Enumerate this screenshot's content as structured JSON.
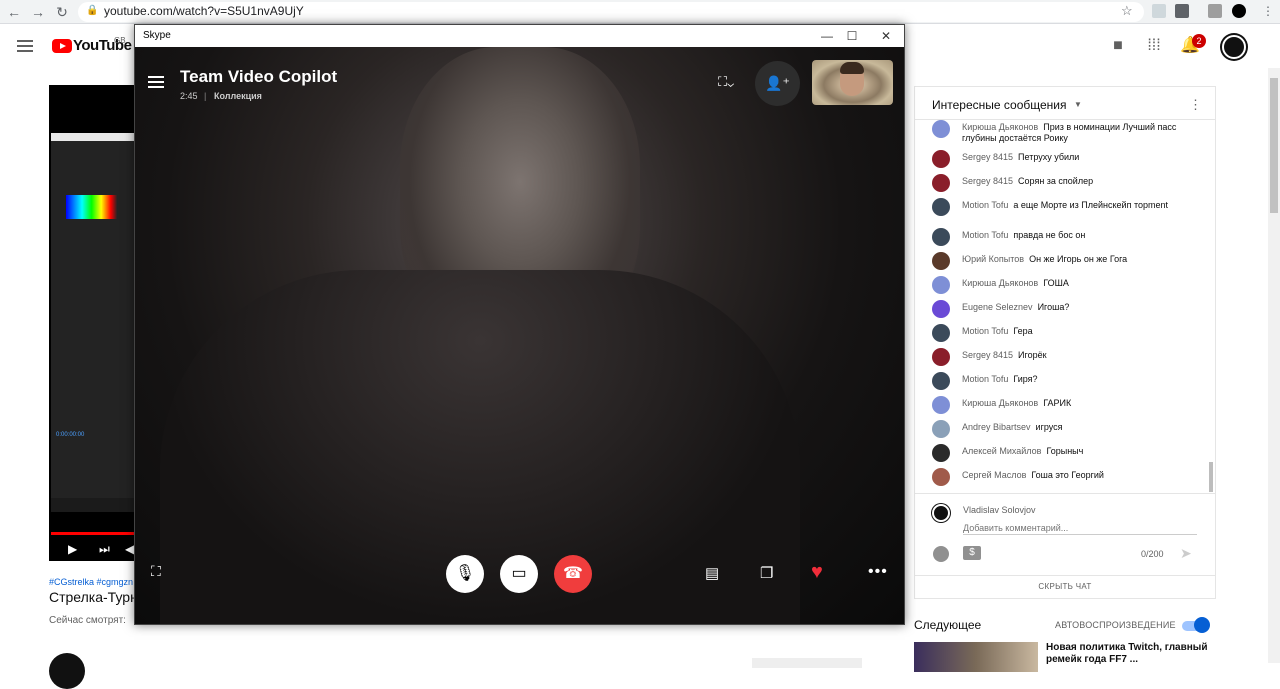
{
  "browser": {
    "url": "youtube.com/watch?v=S5U1nvA9UjY",
    "lock_glyph": "🔒",
    "star_glyph": "☆"
  },
  "youtube": {
    "logo_text": "YouTube",
    "region": "GB",
    "notification_count": "2",
    "video": {
      "tags": "#CGstrelka #cgmgzn",
      "title": "Стрелка-Турн",
      "watching": "Сейчас смотрят:",
      "ae_time": "0:00:00:00"
    },
    "chat": {
      "title": "Интересные сообщения",
      "messages": [
        {
          "author": "Кирюша Дьяконов",
          "text": "Приз в номинации Лучший пасс глубины достаётся Роику",
          "avatar_color": "#7e8fd6"
        },
        {
          "author": "Sergey 8415",
          "text": "Петруху убили",
          "avatar_color": "#8a1e2a"
        },
        {
          "author": "Sergey 8415",
          "text": "Сорян за спойлер",
          "avatar_color": "#8a1e2a"
        },
        {
          "author": "Motion Tofu",
          "text": "а еще Морте из Плейнскейп торment",
          "avatar_color": "#3b4a5a"
        },
        {
          "author": "Motion Tofu",
          "text": "правда не бос он",
          "avatar_color": "#3b4a5a"
        },
        {
          "author": "Юрий Копытов",
          "text": "Он же Игорь он же Гога",
          "avatar_color": "#5a3a2a"
        },
        {
          "author": "Кирюша Дьяконов",
          "text": "ГОША",
          "avatar_color": "#7e8fd6"
        },
        {
          "author": "Eugene Seleznev",
          "text": "Игоша?",
          "avatar_color": "#6a4ad6"
        },
        {
          "author": "Motion Tofu",
          "text": "Гера",
          "avatar_color": "#3b4a5a"
        },
        {
          "author": "Sergey 8415",
          "text": "Игорёк",
          "avatar_color": "#8a1e2a"
        },
        {
          "author": "Motion Tofu",
          "text": "Гиря?",
          "avatar_color": "#3b4a5a"
        },
        {
          "author": "Кирюша Дьяконов",
          "text": "ГАРИК",
          "avatar_color": "#7e8fd6"
        },
        {
          "author": "Andrey Bibartsev",
          "text": "игруся",
          "avatar_color": "#8aa0b8"
        },
        {
          "author": "Алексей Михайлов",
          "text": "Горыныч",
          "avatar_color": "#2a2a2a"
        },
        {
          "author": "Сергей Маслов",
          "text": "Гоша это Георгий",
          "avatar_color": "#a05a4a"
        }
      ],
      "current_user": "Vladislav Solovjov",
      "comment_placeholder": "Добавить комментарий...",
      "char_count": "0/200",
      "hide_chat": "СКРЫТЬ ЧАТ"
    },
    "up_next": {
      "label": "Следующее",
      "autoplay_label": "АВТОВОСПРОИЗВЕДЕНИЕ",
      "autoplay_on": true,
      "video_title": "Новая политика Twitch, главный ремейк года FF7 ..."
    }
  },
  "skype": {
    "window_title": "Skype",
    "call_name": "Team Video Copilot",
    "duration": "2:45",
    "collection_label": "Коллекция",
    "colors": {
      "end_call": "#f03d3d",
      "heart": "#f02d3a"
    }
  }
}
